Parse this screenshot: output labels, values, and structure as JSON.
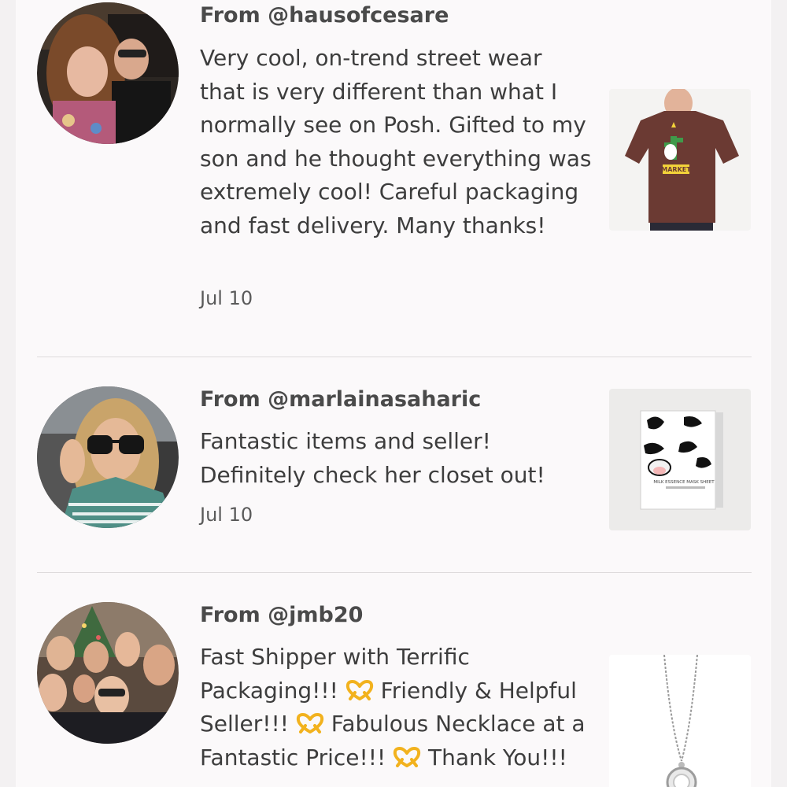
{
  "reviews": [
    {
      "from": "From @hausofcesare",
      "text": "Very cool, on-trend street wear that is very different than what I normally see on Posh. Gifted to my son and he thought everything was extremely cool! Careful packaging and fast delivery. Many thanks!",
      "date": "Jul 10",
      "avatar_icon": "avatar-photo-couple",
      "thumb_icon": "brown-tshirt-photo",
      "thumb_text": "MARKET"
    },
    {
      "from": "From @marlainasaharic",
      "text": "Fantastic items and seller! Definitely check her closet out!",
      "date": "Jul 10",
      "avatar_icon": "avatar-photo-woman-sunglasses",
      "thumb_icon": "cow-print-mask-box-photo",
      "thumb_text": "MILK ESSENCE MASK SHEET"
    },
    {
      "from": "From @jmb20",
      "text_parts": [
        "Fast Shipper with Terrific Packaging!!!",
        "Friendly & Helpful Seller!!!",
        "Fabulous Necklace at a Fantastic Price!!!",
        "Thank You!!!"
      ],
      "avatar_icon": "avatar-photo-family",
      "thumb_icon": "pendant-necklace-photo",
      "emoji": "heart-hands-emoji"
    }
  ]
}
